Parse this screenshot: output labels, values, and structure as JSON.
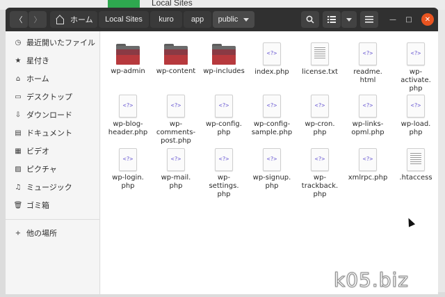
{
  "background": {
    "window_title": "Local Sites"
  },
  "nav": {
    "back_glyph": "〈",
    "forward_glyph": "〉"
  },
  "breadcrumb": {
    "home": "ホーム",
    "items": [
      "Local Sites",
      "kuro",
      "app",
      "public"
    ]
  },
  "toolbar": {
    "search_icon": "search-icon",
    "view_icon": "list-view-icon",
    "menu_icon": "hamburger-menu-icon"
  },
  "window_controls": {
    "minimize": "—",
    "maximize": "□",
    "close": "✕"
  },
  "sidebar": {
    "items": [
      {
        "label": "最近開いたファイル",
        "icon": "clock-icon",
        "glyph": "◷"
      },
      {
        "label": "星付き",
        "icon": "star-icon",
        "glyph": "★"
      },
      {
        "label": "ホーム",
        "icon": "home-icon",
        "glyph": "⌂"
      },
      {
        "label": "デスクトップ",
        "icon": "desktop-icon",
        "glyph": "▭"
      },
      {
        "label": "ダウンロード",
        "icon": "download-icon",
        "glyph": "⇩"
      },
      {
        "label": "ドキュメント",
        "icon": "document-icon",
        "glyph": "▤"
      },
      {
        "label": "ビデオ",
        "icon": "video-icon",
        "glyph": "▦"
      },
      {
        "label": "ピクチャ",
        "icon": "picture-icon",
        "glyph": "▨"
      },
      {
        "label": "ミュージック",
        "icon": "music-icon",
        "glyph": "♫"
      },
      {
        "label": "ゴミ箱",
        "icon": "trash-icon",
        "glyph": "🗑"
      }
    ],
    "other": {
      "label": "他の場所",
      "icon": "plus-icon",
      "glyph": "+"
    }
  },
  "files": [
    {
      "name": "wp-admin",
      "type": "folder"
    },
    {
      "name": "wp-content",
      "type": "folder"
    },
    {
      "name": "wp-includes",
      "type": "folder"
    },
    {
      "name": "index.php",
      "type": "php"
    },
    {
      "name": "license.txt",
      "type": "text"
    },
    {
      "name": "readme.\nhtml",
      "type": "php"
    },
    {
      "name": "wp-\nactivate.\nphp",
      "type": "php"
    },
    {
      "name": "wp-blog-\nheader.php",
      "type": "php"
    },
    {
      "name": "wp-\ncomments-\npost.php",
      "type": "php"
    },
    {
      "name": "wp-config.\nphp",
      "type": "php"
    },
    {
      "name": "wp-config-\nsample.php",
      "type": "php"
    },
    {
      "name": "wp-cron.\nphp",
      "type": "php"
    },
    {
      "name": "wp-links-\nopml.php",
      "type": "php"
    },
    {
      "name": "wp-load.\nphp",
      "type": "php"
    },
    {
      "name": "wp-login.\nphp",
      "type": "php"
    },
    {
      "name": "wp-mail.\nphp",
      "type": "php"
    },
    {
      "name": "wp-\nsettings.\nphp",
      "type": "php"
    },
    {
      "name": "wp-signup.\nphp",
      "type": "php"
    },
    {
      "name": "wp-\ntrackback.\nphp",
      "type": "php"
    },
    {
      "name": "xmlrpc.php",
      "type": "php"
    },
    {
      "name": ".htaccess",
      "type": "text"
    }
  ],
  "php_glyph": "<?>",
  "watermark": "k05.biz",
  "colors": {
    "accent": "#e95420",
    "folder": "#b7393d",
    "php_glyph": "#6b5bd2"
  }
}
